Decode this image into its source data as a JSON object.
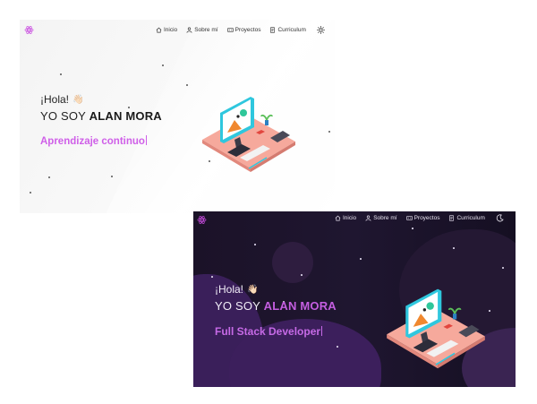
{
  "light": {
    "nav": [
      {
        "label": "Inicio",
        "icon": "home-icon"
      },
      {
        "label": "Sobre mí",
        "icon": "user-icon"
      },
      {
        "label": "Proyectos",
        "icon": "folder-code-icon"
      },
      {
        "label": "Curriculum",
        "icon": "document-icon"
      }
    ],
    "theme_icon": "sun-icon",
    "greeting": "¡Hola!",
    "wave": "👋🏻",
    "intro": "YO SOY",
    "name": "ALAN MORA",
    "tagline": "Aprendizaje continuo"
  },
  "dark": {
    "nav": [
      {
        "label": "Inicio",
        "icon": "home-icon"
      },
      {
        "label": "Sobre mí",
        "icon": "user-icon"
      },
      {
        "label": "Proyectos",
        "icon": "folder-code-icon"
      },
      {
        "label": "Curriculum",
        "icon": "document-icon"
      }
    ],
    "theme_icon": "moon-icon",
    "greeting": "¡Hola!",
    "wave": "👋🏻",
    "intro": "YO SOY",
    "name": "ALAN MORA",
    "tagline": "Full Stack Developer"
  },
  "colors": {
    "accent": "#c65ee2",
    "logo": "#c94ce0",
    "dark_bg": "#1d142c",
    "desk": "#f5a99a",
    "monitor": "#3ad1e6"
  }
}
